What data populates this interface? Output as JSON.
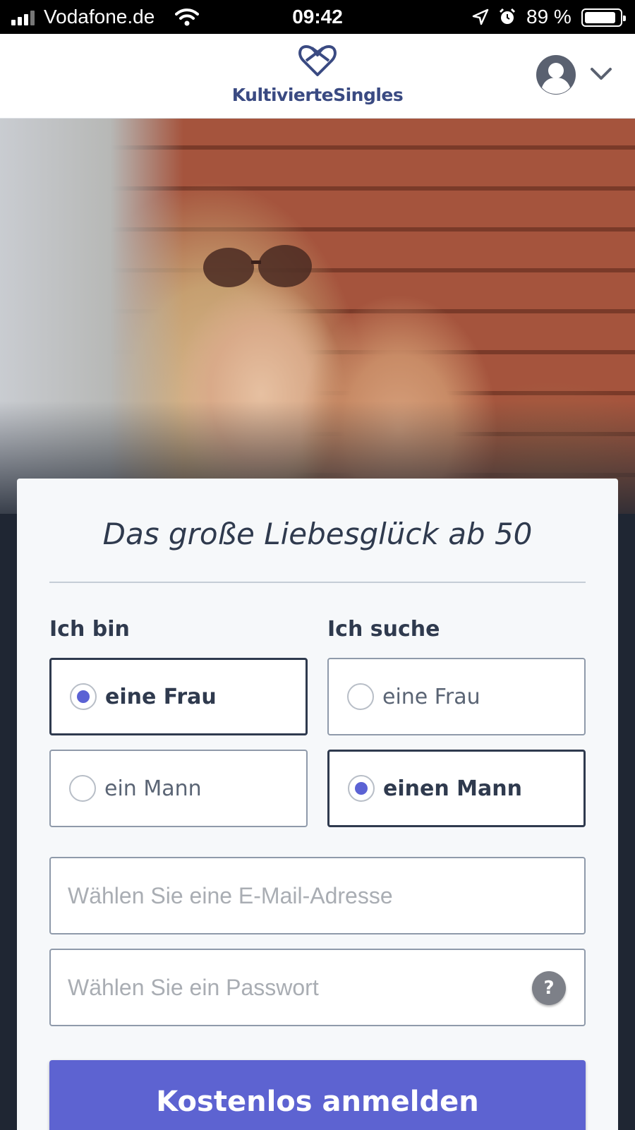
{
  "status_bar": {
    "carrier": "Vodafone.de",
    "time": "09:42",
    "battery_percent_label": "89 %",
    "battery_level": 0.89,
    "icons": [
      "signal-icon",
      "wifi-icon",
      "location-arrow-icon",
      "alarm-icon",
      "battery-icon"
    ]
  },
  "header": {
    "logo_text": "KultivierteSingles",
    "icons": [
      "logo-heart-icon",
      "avatar-icon",
      "chevron-down-icon"
    ],
    "brand_color": "#3a4a82"
  },
  "form": {
    "tagline": "Das große Liebesglück ab 50",
    "i_am": {
      "label": "Ich bin",
      "options": [
        {
          "label": "eine Frau",
          "selected": true
        },
        {
          "label": "ein Mann",
          "selected": false
        }
      ]
    },
    "seeking": {
      "label": "Ich suche",
      "options": [
        {
          "label": "eine Frau",
          "selected": false
        },
        {
          "label": "einen Mann",
          "selected": true
        }
      ]
    },
    "email_placeholder": "Wählen Sie eine E-Mail-Adresse",
    "password_placeholder": "Wählen Sie ein Passwort",
    "password_help": "?",
    "submit_label": "Kostenlos anmelden",
    "accent_color": "#5d63d1"
  }
}
